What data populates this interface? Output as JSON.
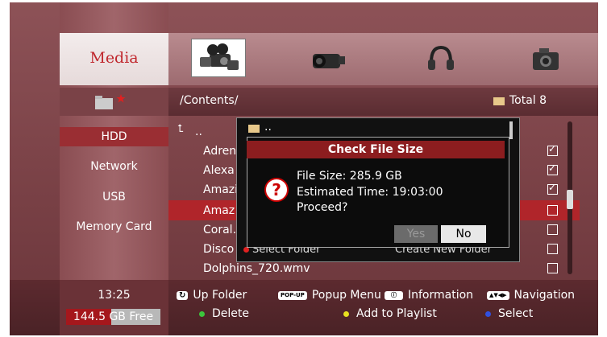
{
  "header": {
    "title": "Media"
  },
  "tabs": [
    {
      "name": "all-media-icon"
    },
    {
      "name": "video-icon"
    },
    {
      "name": "music-icon"
    },
    {
      "name": "photo-icon"
    }
  ],
  "path": {
    "current": "/Contents/",
    "total": "Total 8"
  },
  "sources": [
    "HDD",
    "Network",
    "USB",
    "Memory Card"
  ],
  "files": [
    {
      "name": "..",
      "checked": false
    },
    {
      "name": "Adren",
      "checked": true
    },
    {
      "name": "Alexa",
      "checked": true
    },
    {
      "name": "Amazi",
      "checked": true
    },
    {
      "name": "Amaz",
      "checked": false
    },
    {
      "name": "Coral.",
      "checked": false
    },
    {
      "name": "Disco",
      "checked": false
    },
    {
      "name": "Dolphins_720.wmv",
      "checked": false
    }
  ],
  "folder_popup": {
    "parent": "..",
    "select_folder": "Select Folder",
    "create_new_folder": "Create New Folder"
  },
  "dialog": {
    "title": "Check File Size",
    "file_size": "File Size: 285.9 GB",
    "estimated_time": "Estimated Time: 19:03:00",
    "proceed": "Proceed?",
    "yes": "Yes",
    "no": "No"
  },
  "status": {
    "clock": "13:25",
    "free": "144.5 GB Free",
    "used_fraction": 0.48
  },
  "hints": {
    "up_folder": "Up Folder",
    "popup_key": "POP-UP",
    "popup_menu": "Popup Menu",
    "information": "Information",
    "navigation": "Navigation",
    "delete": "Delete",
    "add_to_playlist": "Add to Playlist",
    "select": "Select"
  },
  "colors": {
    "accent": "#b0252a",
    "green": "#3cc53c",
    "yellow": "#e8e020",
    "blue": "#3050e0"
  }
}
